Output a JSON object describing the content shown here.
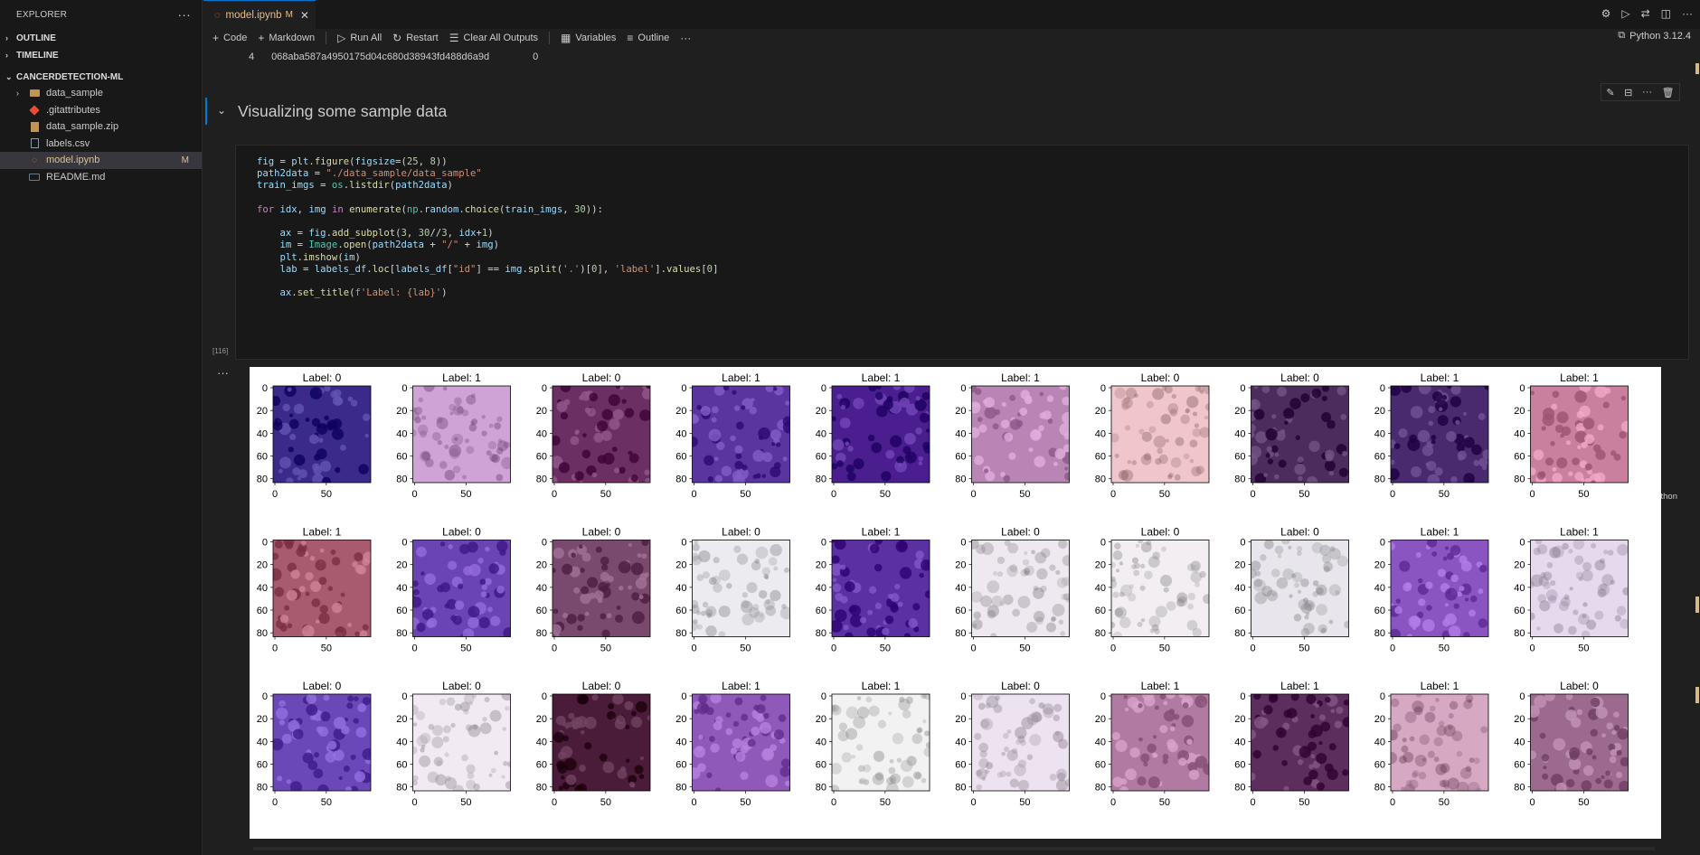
{
  "sidebar": {
    "title": "EXPLORER",
    "sections": {
      "outline": "OUTLINE",
      "timeline": "TIMELINE",
      "project": "CANCERDETECTION-ML"
    },
    "items": [
      {
        "label": "data_sample",
        "icon": "folder-icon"
      },
      {
        "label": ".gitattributes",
        "icon": "git-icon"
      },
      {
        "label": "data_sample.zip",
        "icon": "zip-icon"
      },
      {
        "label": "labels.csv",
        "icon": "csv-icon"
      },
      {
        "label": "model.ipynb",
        "icon": "notebook-icon",
        "badge": "M"
      },
      {
        "label": "README.md",
        "icon": "markdown-icon"
      }
    ]
  },
  "tab": {
    "label": "model.ipynb",
    "modified": "M"
  },
  "toolbar": {
    "code": "Code",
    "markdown": "Markdown",
    "run_all": "Run All",
    "restart": "Restart",
    "clear": "Clear All Outputs",
    "variables": "Variables",
    "outline": "Outline"
  },
  "kernel": "Python 3.12.4",
  "prev_output": {
    "index": "4",
    "id": "068aba587a4950175d04c680d38943fd488d6a9d",
    "label": "0"
  },
  "markdown_heading": "Visualizing some sample data",
  "code_cell": {
    "lines": [
      "fig = plt.figure(figsize=(25, 8))",
      "path2data = \"./data_sample/data_sample\"",
      "train_imgs = os.listdir(path2data)",
      "",
      "for idx, img in enumerate(np.random.choice(train_imgs, 30)):",
      "",
      "    ax = fig.add_subplot(3, 30//3, idx+1)",
      "    im = Image.open(path2data + \"/\" + img)",
      "    plt.imshow(im)",
      "    lab = labels_df.loc[labels_df[\"id\"] == img.split('.')[0], 'label'].values[0]",
      "",
      "    ax.set_title(f'Label: {lab}')"
    ],
    "exec_count": "[116]",
    "language": "Python"
  },
  "figure": {
    "title_prefix": "Label: ",
    "labels": [
      0,
      1,
      0,
      1,
      1,
      1,
      0,
      0,
      1,
      1,
      1,
      0,
      0,
      0,
      1,
      0,
      0,
      0,
      1,
      1,
      0,
      0,
      0,
      1,
      1,
      0,
      1,
      1,
      1,
      0
    ],
    "yticks": [
      "0",
      "20",
      "40",
      "60",
      "80"
    ],
    "xticks": [
      "0",
      "50"
    ],
    "tissue_colors": [
      "#3b2a8a",
      "#cfa3d6",
      "#6b2f63",
      "#5a35a0",
      "#4a1e8f",
      "#b885b5",
      "#f0c6cc",
      "#4b2c5c",
      "#4a2a6e",
      "#c9809f",
      "#a85a6e",
      "#6b44b3",
      "#7a4a6e",
      "#ececf0",
      "#5b30a0",
      "#eee8f0",
      "#f2eef2",
      "#e8e6ec",
      "#8a55c0",
      "#e6d9ee",
      "#6b48b8",
      "#f1eaf3",
      "#4a1c3a",
      "#8e59b8",
      "#f2f2f2",
      "#ede2ef",
      "#b17aa2",
      "#5b2e5e",
      "#d6a8c2",
      "#9b6a8e"
    ]
  }
}
